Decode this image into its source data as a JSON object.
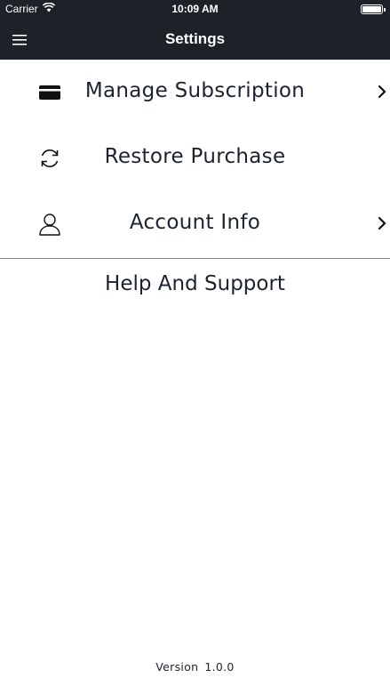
{
  "status_bar": {
    "carrier": "Carrier",
    "time": "10:09 AM",
    "icons": [
      "wifi-icon",
      "battery-icon"
    ]
  },
  "nav": {
    "title": "Settings",
    "menu_icon": "hamburger-menu-icon"
  },
  "menu": {
    "items": [
      {
        "label": "Manage Subscription",
        "icon": "credit-card-icon",
        "has_chevron": true
      },
      {
        "label": "Restore Purchase",
        "icon": "refresh-icon",
        "has_chevron": false
      },
      {
        "label": "Account Info",
        "icon": "user-icon",
        "has_chevron": true
      }
    ],
    "help_label": "Help And Support"
  },
  "footer": {
    "version_label": "Version",
    "version_number": "1.0.0"
  },
  "colors": {
    "nav_background": "#1d2228",
    "text": "#1c2230",
    "divider": "#8a8a8a"
  }
}
